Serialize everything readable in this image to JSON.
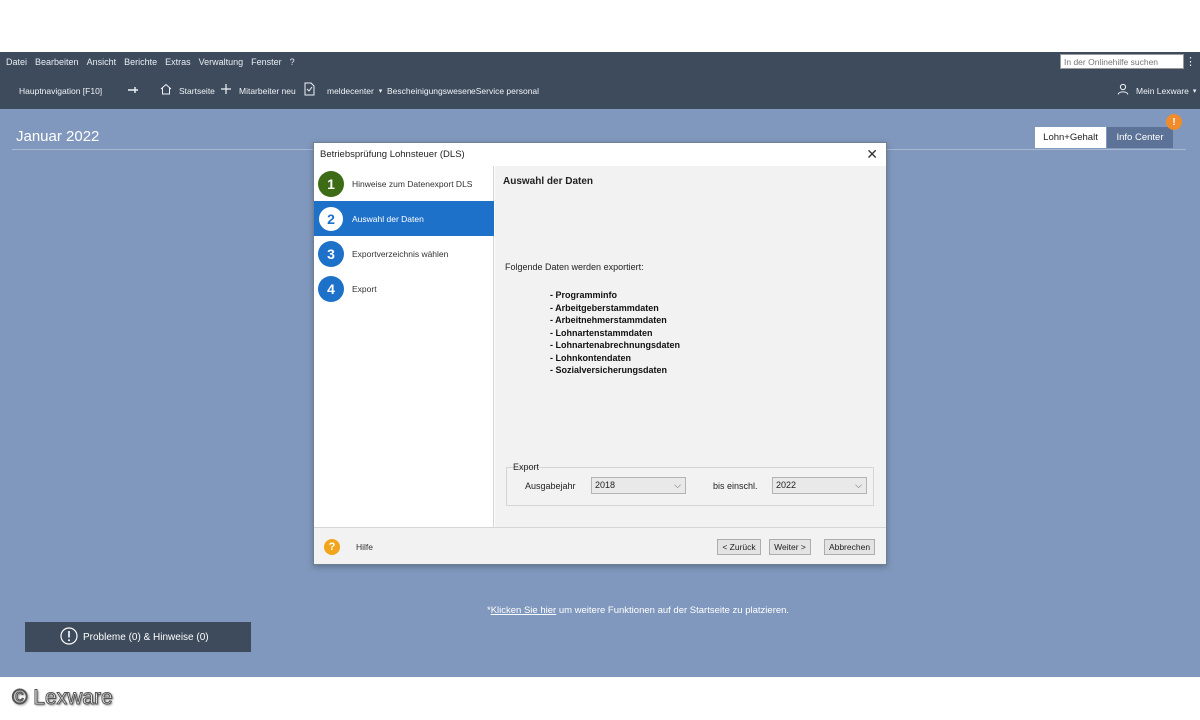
{
  "menu": {
    "items": [
      "Datei",
      "Bearbeiten",
      "Ansicht",
      "Berichte",
      "Extras",
      "Verwaltung",
      "Fenster",
      "?"
    ],
    "search_placeholder": "In der Onlinehilfe suchen"
  },
  "nav": {
    "hauptnavigation": "Hauptnavigation [F10]",
    "startseite": "Startseite",
    "mitarbeiter_neu": "Mitarbeiter neu",
    "meldecenter": "meldecenter",
    "bescheinigungswesen": "Bescheinigungswesen",
    "eservice": "eService personal",
    "mein_lexware": "Mein Lexware"
  },
  "workspace": {
    "period": "Januar 2022",
    "tab_lohn": "Lohn+Gehalt",
    "tab_info": "Info Center",
    "notification": "!",
    "footer_prefix": "*",
    "footer_link": "Klicken Sie hier",
    "footer_text": " um weitere Funktionen auf der Startseite zu platzieren.",
    "problems": "Probleme (0) & Hinweise (0)"
  },
  "dialog": {
    "title": "Betriebsprüfung Lohnsteuer (DLS)",
    "steps": [
      {
        "num": "1",
        "label": "Hinweise zum Datenexport DLS",
        "color": "#3d6b16"
      },
      {
        "num": "2",
        "label": "Auswahl der Daten",
        "color": "#1e71c9"
      },
      {
        "num": "3",
        "label": "Exportverzeichnis wählen",
        "color": "#1e71c9"
      },
      {
        "num": "4",
        "label": "Export",
        "color": "#1e71c9"
      }
    ],
    "section_title": "Auswahl der Daten",
    "intro": "Folgende Daten werden exportiert:",
    "data_items": [
      "Programminfo",
      "Arbeitgeberstammdaten",
      "Arbeitnehmerstammdaten",
      "Lohnartenstammdaten",
      "Lohnartenabrechnungsdaten",
      "Lohnkontendaten",
      "Sozialversicherungsdaten"
    ],
    "export": {
      "group_label": "Export",
      "from_label": "Ausgabejahr",
      "from_value": "2018",
      "to_label": "bis einschl.",
      "to_value": "2022"
    },
    "help": "Hilfe",
    "btn_back": "< Zurück",
    "btn_next": "Weiter >",
    "btn_cancel": "Abbrechen"
  },
  "copyright": "© Lexware"
}
